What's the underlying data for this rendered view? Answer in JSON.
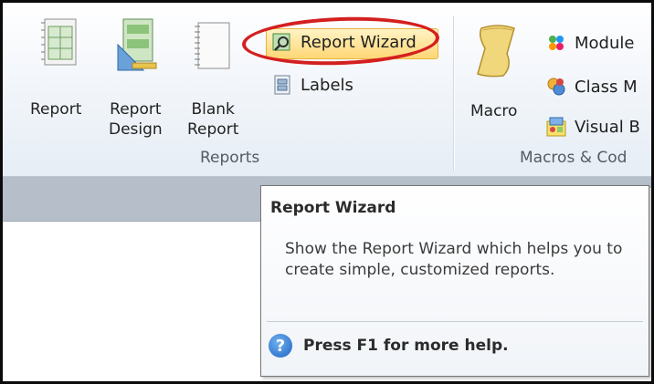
{
  "reports_group": {
    "label": "Reports",
    "report": {
      "label": "Report"
    },
    "report_design": {
      "label": "Report\nDesign"
    },
    "blank_report": {
      "label": "Blank\nReport"
    },
    "report_wizard": {
      "label": "Report Wizard"
    },
    "labels": {
      "label": "Labels"
    }
  },
  "macros_group": {
    "label": "Macros & Cod",
    "macro": {
      "label": "Macro"
    },
    "module": {
      "label": "Module"
    },
    "class_module": {
      "label": "Class M"
    },
    "visual_basic": {
      "label": "Visual B"
    }
  },
  "tooltip": {
    "title": "Report Wizard",
    "body": "Show the Report Wizard which helps you to create simple, customized reports.",
    "help": "Press F1 for more help."
  },
  "colors": {
    "highlight_circle": "#d41f1f",
    "accent_blue": "#1f64c3"
  }
}
